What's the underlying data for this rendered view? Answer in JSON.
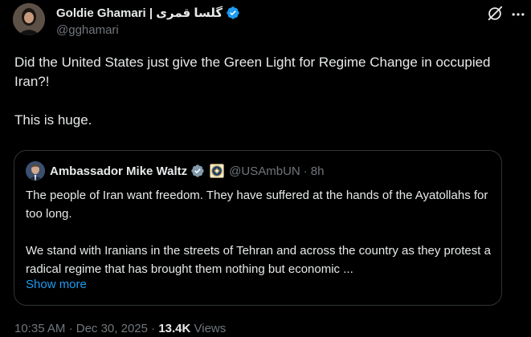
{
  "author": {
    "display_name": "Goldie Ghamari | گلسا قمری",
    "handle": "@gghamari",
    "verified": true,
    "badge_color": "#1d9bf0"
  },
  "tweet": {
    "paragraph_1": "Did the United States just give the Green Light for Regime Change in occupied Iran?!",
    "paragraph_2": "This is huge."
  },
  "quoted": {
    "display_name": "Ambassador Mike Waltz",
    "verified_badge": "gray",
    "badge_color": "#829aab",
    "affiliation_icon": "us-seal-icon",
    "handle": "@USAmbUN",
    "separator": "·",
    "time": "8h",
    "paragraph_1": "The people of Iran want freedom. They have suffered at the hands of the Ayatollahs for too long.",
    "paragraph_2": "We stand with Iranians in the streets of Tehran and across the country as they protest a radical regime that has brought them nothing but economic ...",
    "show_more": "Show more"
  },
  "meta": {
    "time": "10:35 AM",
    "separator_1": "·",
    "date": "Dec 30, 2025",
    "separator_2": "·",
    "views_count": "13.4K",
    "views_label": "Views"
  },
  "icons": {
    "grok": "grok-icon",
    "more": "more-icon"
  },
  "colors": {
    "background": "#000000",
    "text": "#e7e9ea",
    "muted": "#71767b",
    "link": "#1d9bf0",
    "border": "#2f3336"
  }
}
